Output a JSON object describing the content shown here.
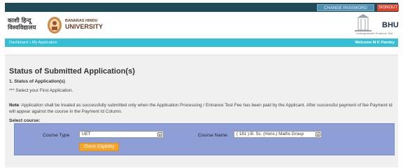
{
  "topbar": {
    "change_password": "CHANGE PASSWORD",
    "signout": "SIGNOUT"
  },
  "header": {
    "hindi_line1": "काशी हिन्दू",
    "hindi_line2": "विश्वविद्यालय",
    "uni_line1": "BANARAS HINDU",
    "uni_line2": "UNIVERSITY",
    "bhu": "BHU",
    "bhu_sub": "Undergraduate Entrance Test"
  },
  "nav": {
    "crumb_dashboard": "Dashboard",
    "crumb_sep": "»",
    "crumb_current": "My Application",
    "welcome": "Welcome M K Pandey"
  },
  "main": {
    "title": "Status of Submitted Application(s)",
    "section_1": "1. Status of Application(s)",
    "select_first": "*** Select your First Application.",
    "note_label": "Note",
    "note_text": ": Application shall be treated as successfully submitted only when the Application Processing / Entrance Test Fee has been paid by the Applicant. After successful payment of fee Payment id will appear against the course in the Payment Id Column.",
    "select_course": "Select course:",
    "course_type_label": "Course Type",
    "course_type_value": "UET",
    "course_name_label": "Course Name",
    "course_name_value": "( 181 )-B. Sc. (Hons.) Maths Group",
    "check_button": "Check Eligibility"
  },
  "colors": {
    "topbar": "#1f4a58",
    "nav": "#34bfd7",
    "course_box": "#8d9fd6",
    "check_button": "#f4a52c",
    "signout": "#d9452b"
  }
}
